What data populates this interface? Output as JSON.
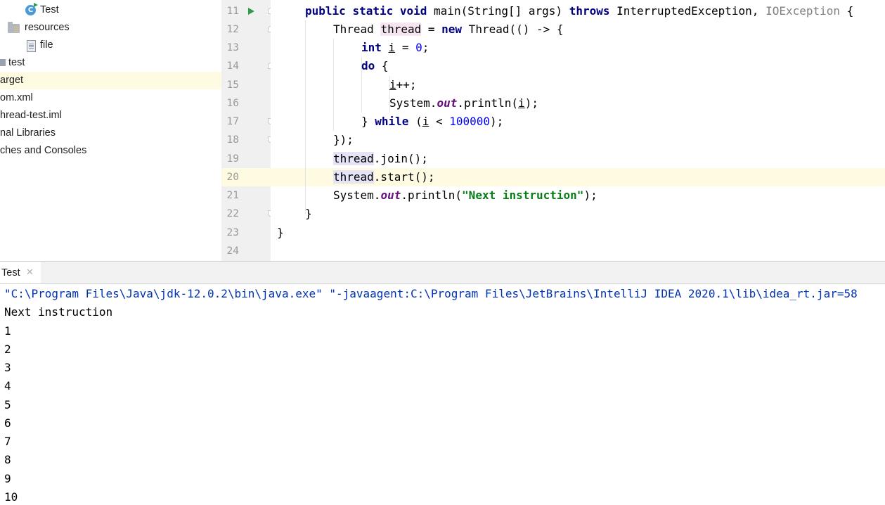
{
  "project_tree": {
    "items": [
      {
        "label": "Test",
        "icon": "java-class-icon"
      },
      {
        "label": "resources",
        "icon": "resources-folder-icon"
      },
      {
        "label": "file",
        "icon": "text-file-icon"
      },
      {
        "label": "test",
        "icon": "folder-icon"
      },
      {
        "label": "arget",
        "icon": "none"
      },
      {
        "label": "om.xml",
        "icon": "none"
      },
      {
        "label": "hread-test.iml",
        "icon": "none"
      },
      {
        "label": "nal Libraries",
        "icon": "none"
      },
      {
        "label": "ches and Consoles",
        "icon": "none"
      }
    ]
  },
  "editor": {
    "line_numbers": [
      "11",
      "12",
      "13",
      "14",
      "15",
      "16",
      "17",
      "18",
      "19",
      "20",
      "21",
      "22",
      "23",
      "24"
    ],
    "tokens": {
      "public": "public",
      "static": "static",
      "void": "void",
      "main": " main(String[] args) ",
      "throws": "throws",
      "exc1": " InterruptedException, ",
      "exc2": "IOException",
      "brace_open": " {",
      "thread_type": "Thread ",
      "thread_var": "thread",
      "assign": " = ",
      "new": "new",
      "thread_ctor": " Thread(() -> {",
      "int": "int",
      "i": "i",
      "eq": " = ",
      "zero": "0",
      "semi": ";",
      "do": "do",
      "do_brace": " {",
      "incr": "++;",
      "system": "System.",
      "out": "out",
      "println_open": ".println(",
      "println_close": ");",
      "close_while": "} ",
      "while": "while",
      "paren_open": " (",
      "lt": " < ",
      "limit": "100000",
      "paren_close": ");",
      "close_lambda": "});",
      "join_call": ".join();",
      "start_call": ".start();",
      "str_open": ".println(",
      "str": "\"Next instruction\"",
      "str_close": ");",
      "close_method": "}",
      "close_class": "}"
    }
  },
  "run_panel": {
    "tab_label": "Test",
    "close_glyph": "✕",
    "output": [
      "\"C:\\Program Files\\Java\\jdk-12.0.2\\bin\\java.exe\" \"-javaagent:C:\\Program Files\\JetBrains\\IntelliJ IDEA 2020.1\\lib\\idea_rt.jar=58",
      "Next instruction",
      "1",
      "2",
      "3",
      "4",
      "5",
      "6",
      "7",
      "8",
      "9",
      "10"
    ]
  }
}
